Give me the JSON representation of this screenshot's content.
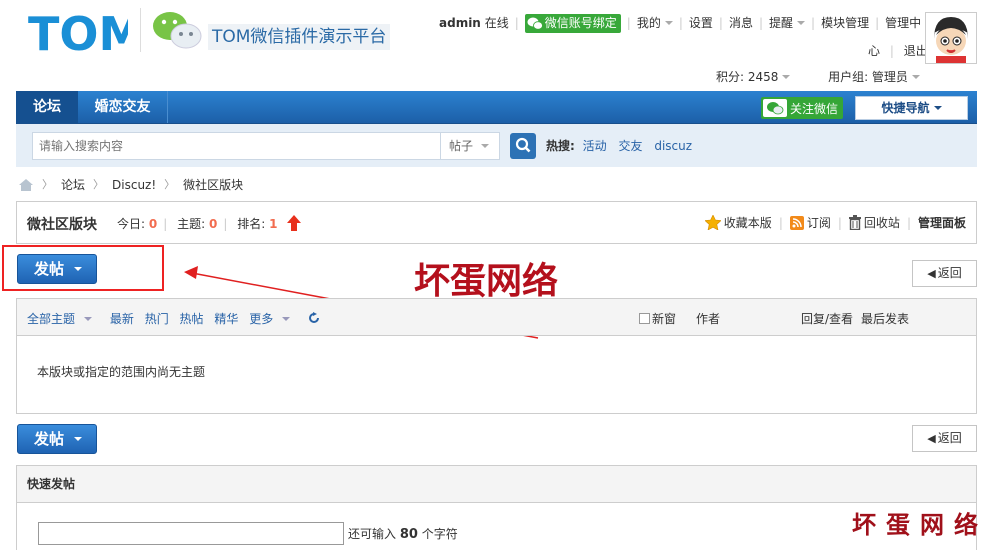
{
  "header": {
    "logo_text": "TOM",
    "site_title": "TOM微信插件演示平台"
  },
  "topnav": {
    "username": "admin",
    "online": "在线",
    "wx_bind": "微信账号绑定",
    "mine": "我的",
    "settings": "设置",
    "messages": "消息",
    "remind": "提醒",
    "module_manage": "模块管理",
    "manage_center_1": "管理中",
    "manage_center_2": "心",
    "logout": "退出"
  },
  "credits": {
    "points": "积分: 2458",
    "usergroup": "用户组: 管理员"
  },
  "mainnav": {
    "tabs": [
      "论坛",
      "婚恋交友"
    ],
    "follow_wx": "关注微信",
    "quick_nav": "快捷导航"
  },
  "search": {
    "placeholder": "请输入搜索内容",
    "type": "帖子",
    "hot_label": "热搜:",
    "hot_links": [
      "活动",
      "交友",
      "discuz"
    ]
  },
  "breadcrumb": [
    "论坛",
    "Discuz!",
    "微社区版块"
  ],
  "forum": {
    "name": "微社区版块",
    "today_label": "今日:",
    "today": "0",
    "topics_label": "主题:",
    "topics": "0",
    "rank_label": "排名:",
    "rank": "1",
    "favorite": "收藏本版",
    "subscribe": "订阅",
    "recycle": "回收站",
    "admin_panel": "管理面板"
  },
  "post_button": "发帖",
  "back_button": "返回",
  "watermark": "坏蛋网络",
  "threadlist": {
    "filters": [
      "全部主题",
      "最新",
      "热门",
      "热帖",
      "精华",
      "更多"
    ],
    "new_window": "新窗",
    "author": "作者",
    "reply_view": "回复/查看",
    "last_post": "最后发表",
    "empty": "本版块或指定的范围内尚无主题"
  },
  "quickpost": {
    "title": "快速发帖",
    "remain_prefix": "还可输入",
    "remain_count": "80",
    "remain_suffix": "个字符"
  },
  "colors": {
    "nav_blue": "#1c5fa8",
    "wx_green": "#35a637",
    "accent_red": "#f26c4f",
    "watermark_red": "#b4101c"
  }
}
